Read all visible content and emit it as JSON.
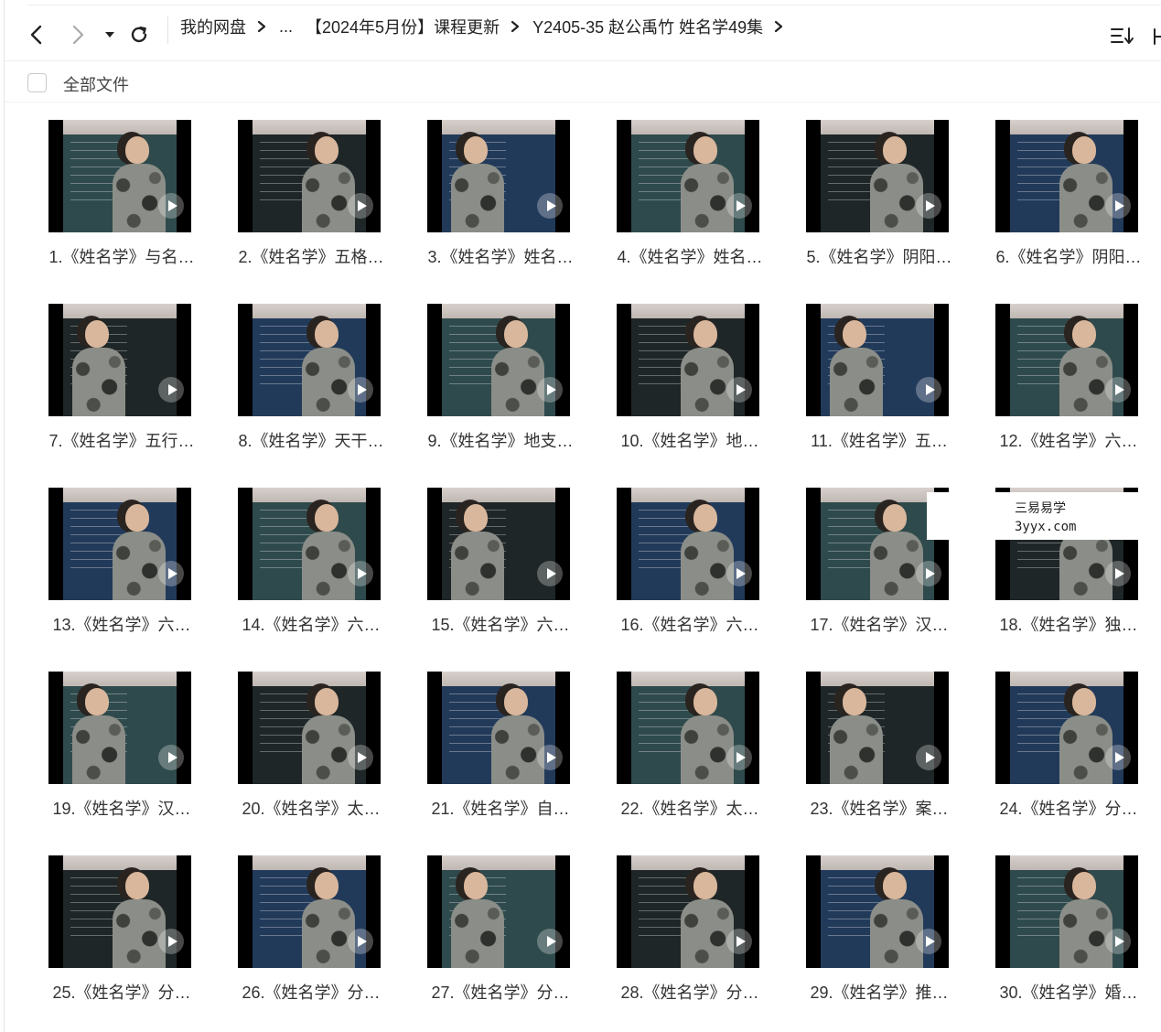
{
  "breadcrumb": {
    "root": "我的网盘",
    "ellipsis": "...",
    "folder": "【2024年5月份】课程更新",
    "current": "Y2405-35 赵公禹竹 姓名学49集"
  },
  "toolbar": {
    "back_icon": "chevron-left-icon",
    "forward_icon": "chevron-right-icon",
    "history_icon": "caret-down-icon",
    "refresh_icon": "refresh-icon",
    "sort_icon": "sort-icon"
  },
  "selection": {
    "label": "全部文件"
  },
  "watermark": {
    "line1": "三易易学",
    "line2": "3yyx.com"
  },
  "files": [
    {
      "name": "1.《姓名学》与名…"
    },
    {
      "name": "2.《姓名学》五格…"
    },
    {
      "name": "3.《姓名学》姓名…"
    },
    {
      "name": "4.《姓名学》姓名…"
    },
    {
      "name": "5.《姓名学》阴阳…"
    },
    {
      "name": "6.《姓名学》阴阳…"
    },
    {
      "name": "7.《姓名学》五行…"
    },
    {
      "name": "8.《姓名学》天干…"
    },
    {
      "name": "9.《姓名学》地支…"
    },
    {
      "name": "10.《姓名学》地…"
    },
    {
      "name": "11.《姓名学》五…"
    },
    {
      "name": "12.《姓名学》六…"
    },
    {
      "name": "13.《姓名学》六…"
    },
    {
      "name": "14.《姓名学》六…"
    },
    {
      "name": "15.《姓名学》六…"
    },
    {
      "name": "16.《姓名学》六…"
    },
    {
      "name": "17.《姓名学》汉…"
    },
    {
      "name": "18.《姓名学》独…"
    },
    {
      "name": "19.《姓名学》汉…"
    },
    {
      "name": "20.《姓名学》太…"
    },
    {
      "name": "21.《姓名学》自…"
    },
    {
      "name": "22.《姓名学》太…"
    },
    {
      "name": "23.《姓名学》案…"
    },
    {
      "name": "24.《姓名学》分…"
    },
    {
      "name": "25.《姓名学》分…"
    },
    {
      "name": "26.《姓名学》分…"
    },
    {
      "name": "27.《姓名学》分…"
    },
    {
      "name": "28.《姓名学》分…"
    },
    {
      "name": "29.《姓名学》推…"
    },
    {
      "name": "30.《姓名学》婚…"
    }
  ],
  "colors": {
    "board_green": "#2f4a4c",
    "board_dark": "#1f2627",
    "board_screen": "#223a5a",
    "text": "#333333"
  }
}
